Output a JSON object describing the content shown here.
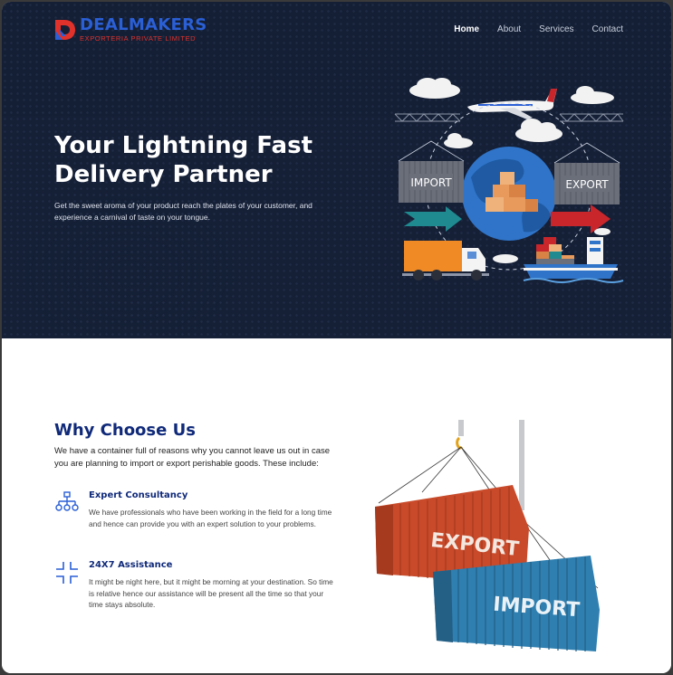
{
  "brand": {
    "name": "DEALMAKERS",
    "tagline": "EXPORTERIA PRIVATE LIMITED",
    "colors": {
      "blue": "#2a5fd6",
      "red": "#e0312b"
    }
  },
  "nav": {
    "items": [
      {
        "label": "Home",
        "active": true
      },
      {
        "label": "About",
        "active": false
      },
      {
        "label": "Services",
        "active": false
      },
      {
        "label": "Contact",
        "active": false
      }
    ]
  },
  "hero": {
    "title_line1": "Your Lightning Fast",
    "title_line2": "Delivery Partner",
    "description": "Get the sweet aroma of your product reach the plates of your customer, and experience a carnival of taste on your tongue.",
    "illustration": {
      "import_label": "IMPORT",
      "export_label": "EXPORT"
    },
    "background": "#152036"
  },
  "why": {
    "title": "Why Choose Us",
    "intro": "We have a container full of reasons why you cannot leave us out in case you are planning to import or export perishable goods. These include:",
    "features": [
      {
        "icon": "network-icon",
        "title": "Expert Consultancy",
        "description": "We have professionals who have been working in the field for a long time and hence can provide you with an expert solution to your problems."
      },
      {
        "icon": "clock-corners-icon",
        "title": "24X7 Assistance",
        "description": "It might be night here, but it might be morning at your destination. So time is relative hence our assistance will be present all the time so that your time stays absolute."
      }
    ],
    "image": {
      "export_label": "EXPORT",
      "import_label": "IMPORT"
    },
    "accent": "#102a7a"
  }
}
